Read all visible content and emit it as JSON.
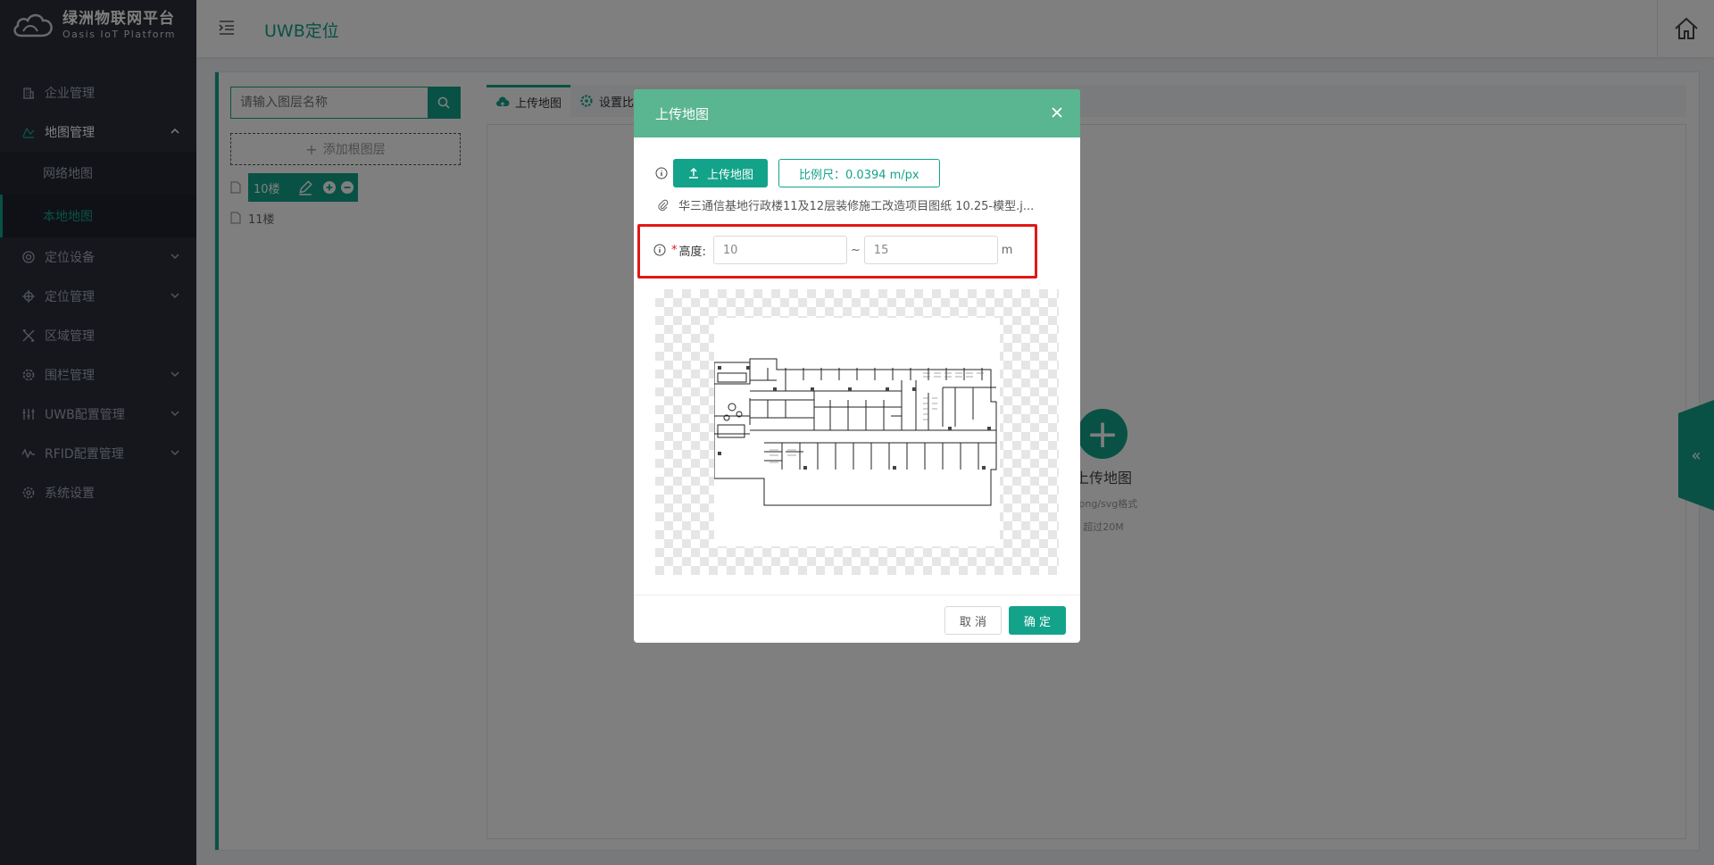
{
  "app": {
    "title": "绿洲物联网平台",
    "subtitle": "Oasis IoT Platform",
    "page_title": "UWB定位"
  },
  "sidebar": {
    "items": [
      {
        "label": "企业管理"
      },
      {
        "label": "地图管理"
      },
      {
        "label": "网络地图"
      },
      {
        "label": "本地地图"
      },
      {
        "label": "定位设备"
      },
      {
        "label": "定位管理"
      },
      {
        "label": "区域管理"
      },
      {
        "label": "围栏管理"
      },
      {
        "label": "UWB配置管理"
      },
      {
        "label": "RFID配置管理"
      },
      {
        "label": "系统设置"
      }
    ]
  },
  "layer_panel": {
    "search_placeholder": "请输入图层名称",
    "add_root": "添加根图层",
    "layers": [
      {
        "label": "10楼"
      },
      {
        "label": "11楼"
      }
    ]
  },
  "tabs": [
    {
      "label": "上传地图"
    },
    {
      "label": "设置比"
    }
  ],
  "upload_area": {
    "title": "上传地图",
    "hint1": "g/png/svg格式",
    "hint2": "超过20M"
  },
  "dialog": {
    "title": "上传地图",
    "upload_button": "上传地图",
    "scale_button": "比例尺：0.0394 m/px",
    "file_name": "华三通信基地行政楼11及12层装修施工改造项目图纸 10.25-模型.j...",
    "height_label": "高度:",
    "height_min": "10",
    "height_sep": "~",
    "height_max": "15",
    "height_unit": "m",
    "cancel": "取 消",
    "confirm": "确 定"
  },
  "colors": {
    "primary": "#13a38a",
    "header": "#5ab591",
    "sidebar": "#2b2f3a",
    "highlight": "#e01818"
  }
}
